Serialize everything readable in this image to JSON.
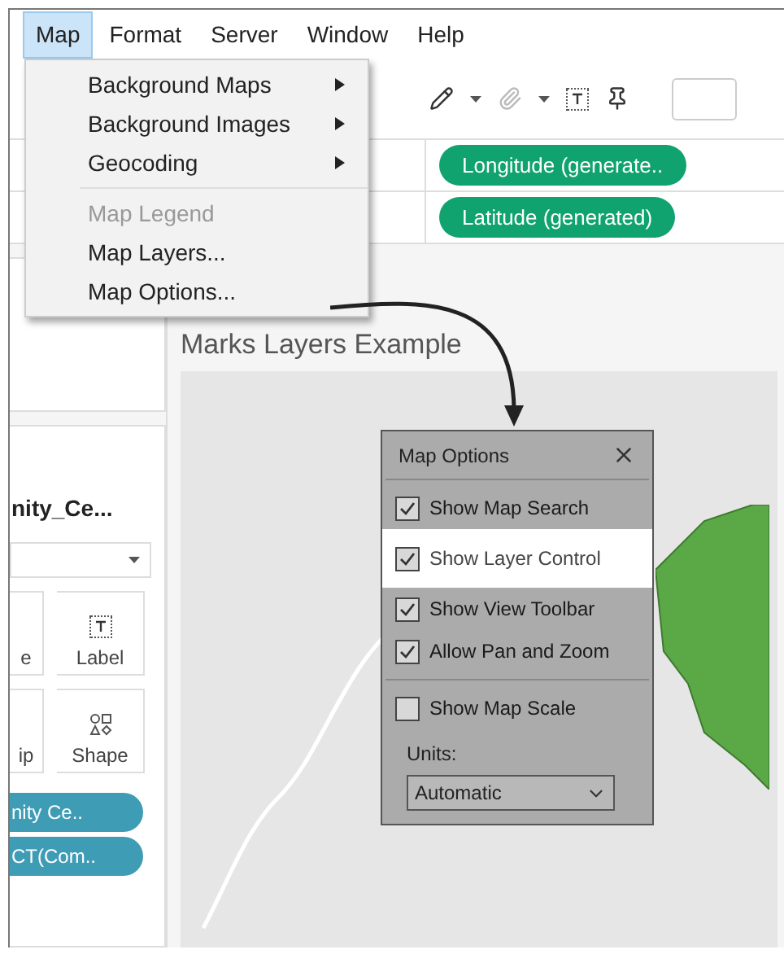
{
  "menu_bar": [
    {
      "label": "Map",
      "selected": true
    },
    {
      "label": "Format",
      "selected": false
    },
    {
      "label": "Server",
      "selected": false
    },
    {
      "label": "Window",
      "selected": false
    },
    {
      "label": "Help",
      "selected": false
    }
  ],
  "map_menu": {
    "groups": [
      [
        {
          "label": "Background Maps",
          "kind": "submenu",
          "disabled": false
        },
        {
          "label": "Background Images",
          "kind": "submenu",
          "disabled": false
        },
        {
          "label": "Geocoding",
          "kind": "submenu",
          "disabled": false
        }
      ],
      [
        {
          "label": "Map Legend",
          "kind": "item",
          "disabled": true
        },
        {
          "label": "Map Layers...",
          "kind": "item",
          "disabled": false
        },
        {
          "label": "Map Options...",
          "kind": "item",
          "disabled": false
        }
      ]
    ]
  },
  "shelves": [
    {
      "pill": "Longitude (generate.."
    },
    {
      "pill": "Latitude (generated)"
    }
  ],
  "marks_card": {
    "title": "nity_Ce...",
    "buttons": [
      {
        "label": "e",
        "kind": "cut"
      },
      {
        "label": "Label",
        "kind": "label"
      },
      {
        "label": "ip",
        "kind": "cut"
      },
      {
        "label": "Shape",
        "kind": "shape"
      }
    ],
    "pills": [
      "nity Ce..",
      "CT(Com.."
    ]
  },
  "view_title": "Marks Layers Example",
  "map_options": {
    "title": "Map Options",
    "groups": [
      [
        {
          "label": "Show Map Search",
          "checked": true,
          "highlighted": false
        },
        {
          "label": "Show Layer Control",
          "checked": true,
          "highlighted": true
        },
        {
          "label": "Show View Toolbar",
          "checked": true,
          "highlighted": false
        },
        {
          "label": "Allow Pan and Zoom",
          "checked": true,
          "highlighted": false
        }
      ],
      [
        {
          "label": "Show Map Scale",
          "checked": false,
          "highlighted": false
        }
      ]
    ],
    "units_label": "Units:",
    "units_value": "Automatic"
  }
}
